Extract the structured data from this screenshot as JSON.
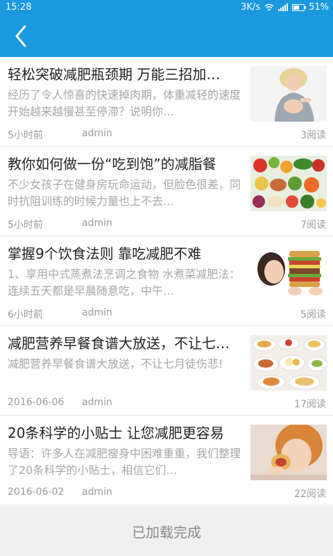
{
  "status_bar": {
    "time": "15:28",
    "network_speed": "3K/s",
    "battery": "51%"
  },
  "header": {
    "back_icon": "chevron-left-icon"
  },
  "articles": [
    {
      "title": "轻松突破减肥瓶颈期 万能三招加…",
      "summary": "经历了令人惊喜的快速掉肉期，体重减轻的速度开始越来越慢甚至停滞？说明你…",
      "time": "5小时前",
      "author": "admin",
      "reads": "3阅读"
    },
    {
      "title": "教你如何做一份“吃到饱”的减脂餐",
      "summary": "不少女孩子在健身房玩命运动，但脸色很差，同时抗阻训练的时候力量也上不去…",
      "time": "5小时前",
      "author": "admin",
      "reads": "7阅读"
    },
    {
      "title": "掌握9个饮食法则 靠吃减肥不难",
      "summary": "1、享用中式蒸煮法烹调之食物 水煮菜减肥法：连续五天都是早晨随意吃，中午…",
      "time": "6小时前",
      "author": "admin",
      "reads": "5阅读"
    },
    {
      "title": "减肥营养早餐食谱大放送，不让七…",
      "summary": "减肥营养早餐食谱大放送，不让七月徒伤悲!",
      "time": "2016-06-06",
      "author": "admin",
      "reads": "17阅读"
    },
    {
      "title": "20条科学的小贴士 让您减肥更容易",
      "summary": "导语：许多人在减肥瘦身中困难重重，我们整理了20条科学的小贴士，相信它们…",
      "time": "2016-06-02",
      "author": "admin",
      "reads": "22阅读"
    }
  ],
  "footer": {
    "status": "已加载完成"
  },
  "colors": {
    "primary": "#1a99df",
    "title": "#222222",
    "summary": "#a6a6a6",
    "meta": "#9a9a9a",
    "footer_bg": "#f0f0f0"
  }
}
